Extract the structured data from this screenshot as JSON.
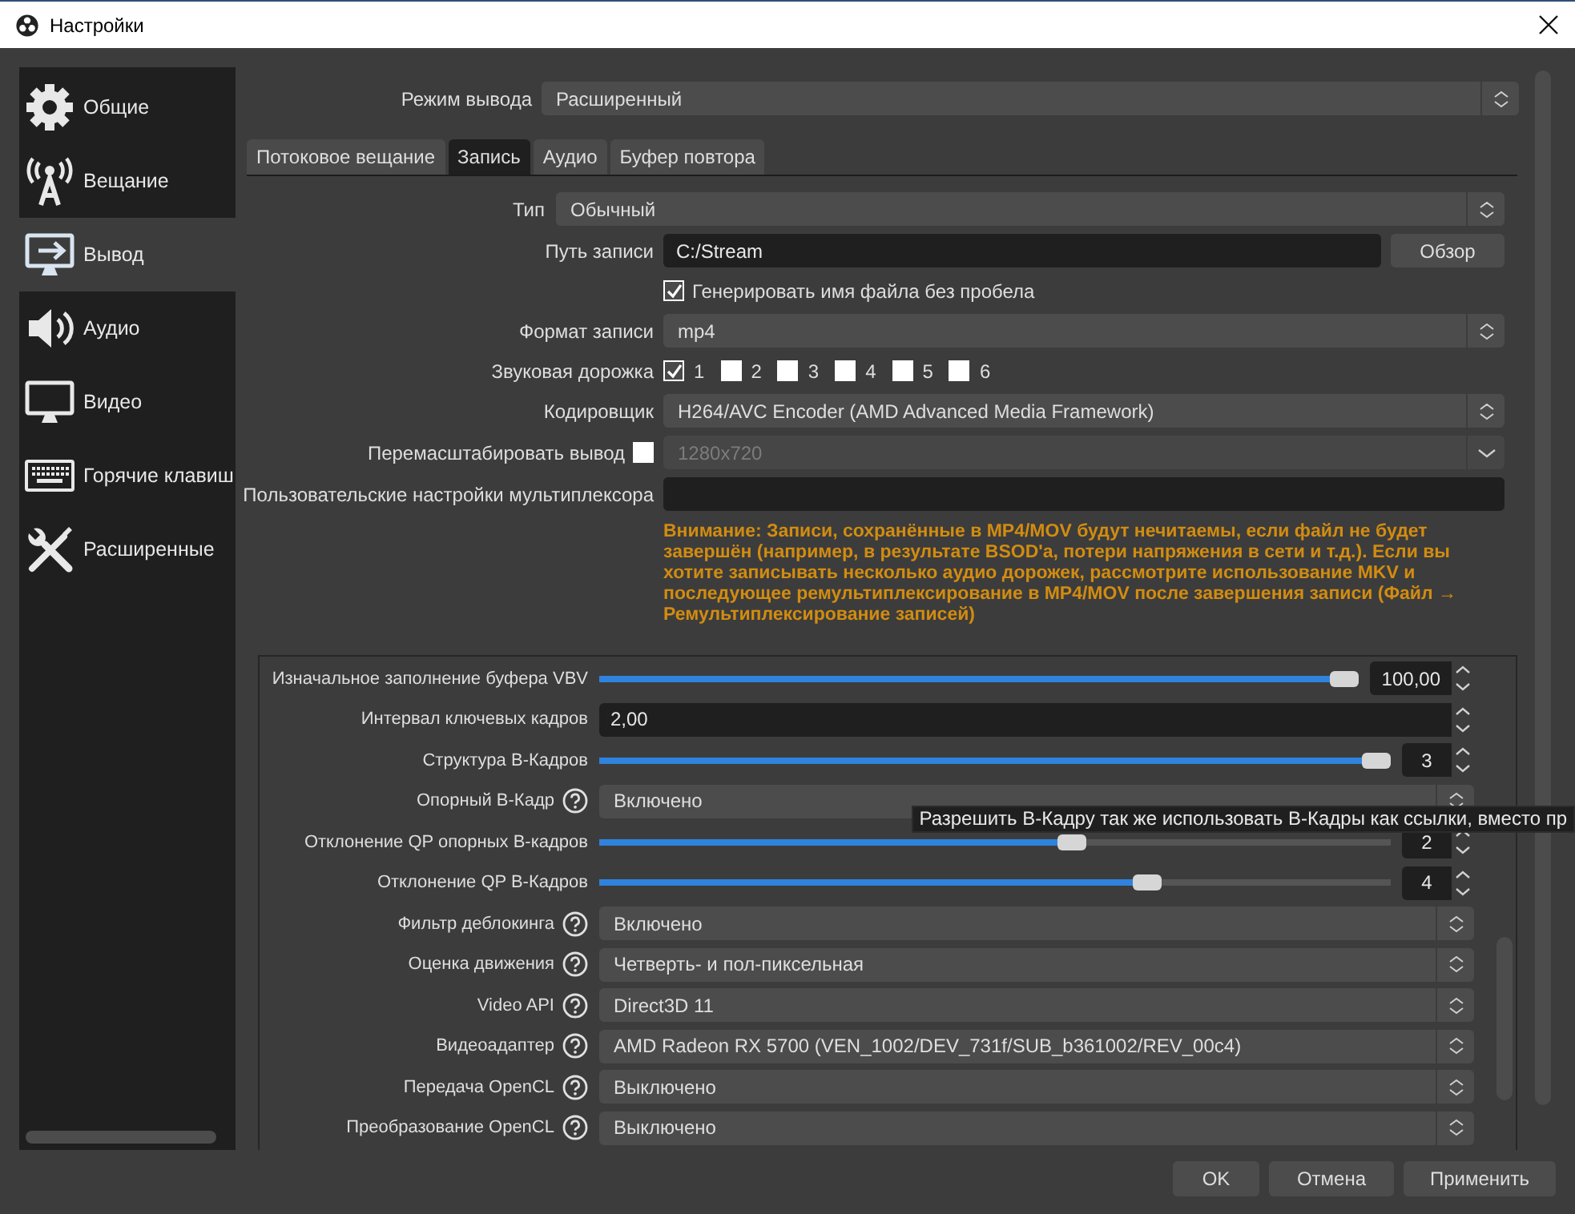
{
  "window": {
    "title": "Настройки"
  },
  "sidebar": {
    "items": [
      {
        "label": "Общие",
        "selected": false
      },
      {
        "label": "Вещание",
        "selected": false
      },
      {
        "label": "Вывод",
        "selected": true
      },
      {
        "label": "Аудио",
        "selected": false
      },
      {
        "label": "Видео",
        "selected": false
      },
      {
        "label": "Горячие клавиш",
        "selected": false
      },
      {
        "label": "Расширенные",
        "selected": false
      }
    ]
  },
  "output_mode": {
    "label": "Режим вывода",
    "value": "Расширенный"
  },
  "tabs": [
    {
      "label": "Потоковое вещание",
      "selected": false
    },
    {
      "label": "Запись",
      "selected": true
    },
    {
      "label": "Аудио",
      "selected": false
    },
    {
      "label": "Буфер повтора",
      "selected": false
    }
  ],
  "recording": {
    "type": {
      "label": "Тип",
      "value": "Обычный"
    },
    "path": {
      "label": "Путь записи",
      "value": "C:/Stream",
      "button": "Обзор"
    },
    "no_space_filename": {
      "label": "Генерировать имя файла без пробела",
      "checked": true
    },
    "format": {
      "label": "Формат записи",
      "value": "mp4"
    },
    "audio_tracks": {
      "label": "Звуковая дорожка",
      "tracks": [
        {
          "label": "1",
          "checked": true
        },
        {
          "label": "2",
          "checked": false
        },
        {
          "label": "3",
          "checked": false
        },
        {
          "label": "4",
          "checked": false
        },
        {
          "label": "5",
          "checked": false
        },
        {
          "label": "6",
          "checked": false
        }
      ]
    },
    "encoder": {
      "label": "Кодировщик",
      "value": "H264/AVC Encoder (AMD Advanced Media Framework)"
    },
    "rescale": {
      "label": "Перемасштабировать вывод",
      "checked": false,
      "value": "1280x720",
      "disabled": true
    },
    "muxer_settings": {
      "label": "Пользовательские настройки мультиплексора"
    },
    "warning": "Внимание: Записи, сохранённые в MP4/MOV будут нечитаемы, если файл не будет завершён (например, в результате BSOD'a, потери напряжения в сети и т.д.). Если вы хотите записывать несколько аудио дорожек, рассмотрите использование MKV и последующее ремультиплексирование в MP4/MOV после завершения записи (Файл → Ремультиплексирование записей)"
  },
  "encoder_settings": [
    {
      "kind": "slider",
      "label": "Изначальное заполнение буфера VBV",
      "help": false,
      "level": 1.0,
      "value": "100,00"
    },
    {
      "kind": "spin",
      "label": "Интервал ключевых кадров",
      "help": false,
      "value": "2,00"
    },
    {
      "kind": "slider",
      "label": "Структура В-Кадров",
      "help": false,
      "level": 1.0,
      "value": "3"
    },
    {
      "kind": "combo",
      "label": "Опорный В-Кадр",
      "help": true,
      "value": "Включено"
    },
    {
      "kind": "slider",
      "label": "Отклонение QP опорных В-кадров",
      "help": false,
      "level": 0.6,
      "value": "2"
    },
    {
      "kind": "slider",
      "label": "Отклонение QP В-Кадров",
      "help": false,
      "level": 0.7,
      "value": "4"
    },
    {
      "kind": "combo",
      "label": "Фильтр деблокинга",
      "help": true,
      "value": "Включено"
    },
    {
      "kind": "combo",
      "label": "Оценка движения",
      "help": true,
      "value": "Четверть- и пол-пиксельная"
    },
    {
      "kind": "combo",
      "label": "Video API",
      "help": true,
      "value": "Direct3D 11"
    },
    {
      "kind": "combo",
      "label": "Видеоадаптер",
      "help": true,
      "value": "AMD Radeon RX 5700 (VEN_1002/DEV_731f/SUB_b361002/REV_00c4)"
    },
    {
      "kind": "combo",
      "label": "Передача OpenCL",
      "help": true,
      "value": "Выключено"
    },
    {
      "kind": "combo",
      "label": "Преобразование OpenCL",
      "help": true,
      "value": "Выключено"
    }
  ],
  "tooltip": "Разрешить В-Кадру так же использовать В-Кадры как ссылки, вместо пр",
  "buttons": [
    "OK",
    "Отмена",
    "Применить"
  ]
}
